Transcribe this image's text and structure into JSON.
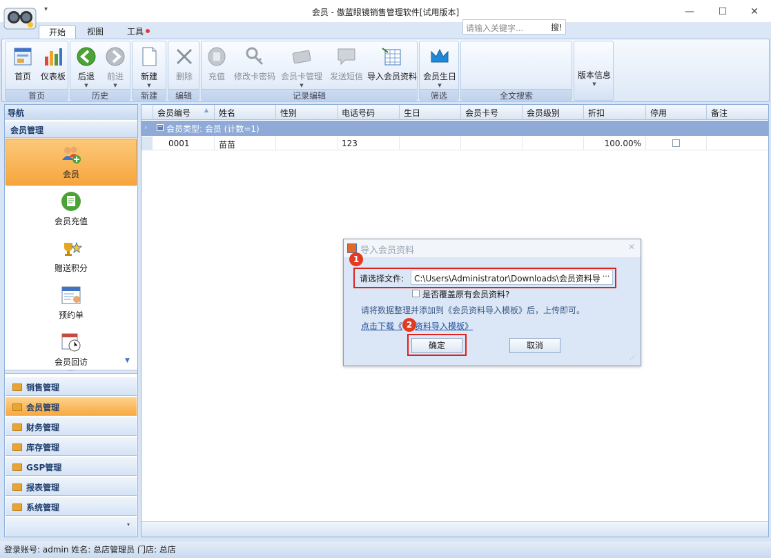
{
  "window": {
    "title": "会员 - 傲蓝眼镜销售管理软件[试用版本]",
    "qat_arrow": "▾"
  },
  "tabs": [
    {
      "label": "开始"
    },
    {
      "label": "视图"
    },
    {
      "label": "工具"
    }
  ],
  "ribbon": {
    "groups": [
      {
        "label": "首页",
        "buttons": [
          "首页",
          "仪表板"
        ]
      },
      {
        "label": "历史",
        "buttons": [
          "后退",
          "前进"
        ]
      },
      {
        "label": "新建",
        "buttons": [
          "新建"
        ]
      },
      {
        "label": "编辑",
        "buttons": [
          "删除"
        ]
      },
      {
        "label": "记录编辑",
        "buttons": [
          "充值",
          "修改卡密码",
          "会员卡管理",
          "发送短信",
          "导入会员资料"
        ]
      },
      {
        "label": "筛选",
        "buttons": [
          "会员生日"
        ]
      },
      {
        "label": "全文搜索"
      },
      {
        "label": "版本信息"
      }
    ],
    "search_placeholder": "请输入关键字...",
    "search_button": "搜!"
  },
  "nav": {
    "header": "导航",
    "section": "会员管理",
    "items": [
      {
        "label": "会员",
        "selected": true
      },
      {
        "label": "会员充值"
      },
      {
        "label": "赠送积分"
      },
      {
        "label": "预约单"
      },
      {
        "label": "会员回访"
      }
    ],
    "categories": [
      {
        "label": "销售管理"
      },
      {
        "label": "会员管理",
        "selected": true
      },
      {
        "label": "财务管理"
      },
      {
        "label": "库存管理"
      },
      {
        "label": "GSP管理"
      },
      {
        "label": "报表管理"
      },
      {
        "label": "系统管理"
      }
    ]
  },
  "grid": {
    "columns": [
      "会员编号",
      "姓名",
      "性别",
      "电话号码",
      "生日",
      "会员卡号",
      "会员级别",
      "折扣",
      "停用",
      "备注"
    ],
    "group_row": "会员类型: 会员 (计数=1)",
    "rows": [
      {
        "id": "0001",
        "name": "苗苗",
        "gender": "",
        "phone": "123",
        "birthday": "",
        "card": "",
        "level": "",
        "discount": "100.00%",
        "disabled": false,
        "remark": ""
      }
    ]
  },
  "dialog": {
    "title": "导入会员资料",
    "file_label": "请选择文件:",
    "file_value": "C:\\Users\\Administrator\\Downloads\\会员资料导入模",
    "browse": "···",
    "overwrite_label": "是否覆盖原有会员资料?",
    "hint": "请将数据整理并添加到《会员资料导入模板》后，上传即可。",
    "download_link_a": "点击下载《",
    "download_link_b": "资料导入模板》",
    "ok": "确定",
    "cancel": "取消",
    "badge1": "1",
    "badge2": "2"
  },
  "status": {
    "text": "登录账号: admin  姓名: 总店管理员  门店: 总店"
  }
}
